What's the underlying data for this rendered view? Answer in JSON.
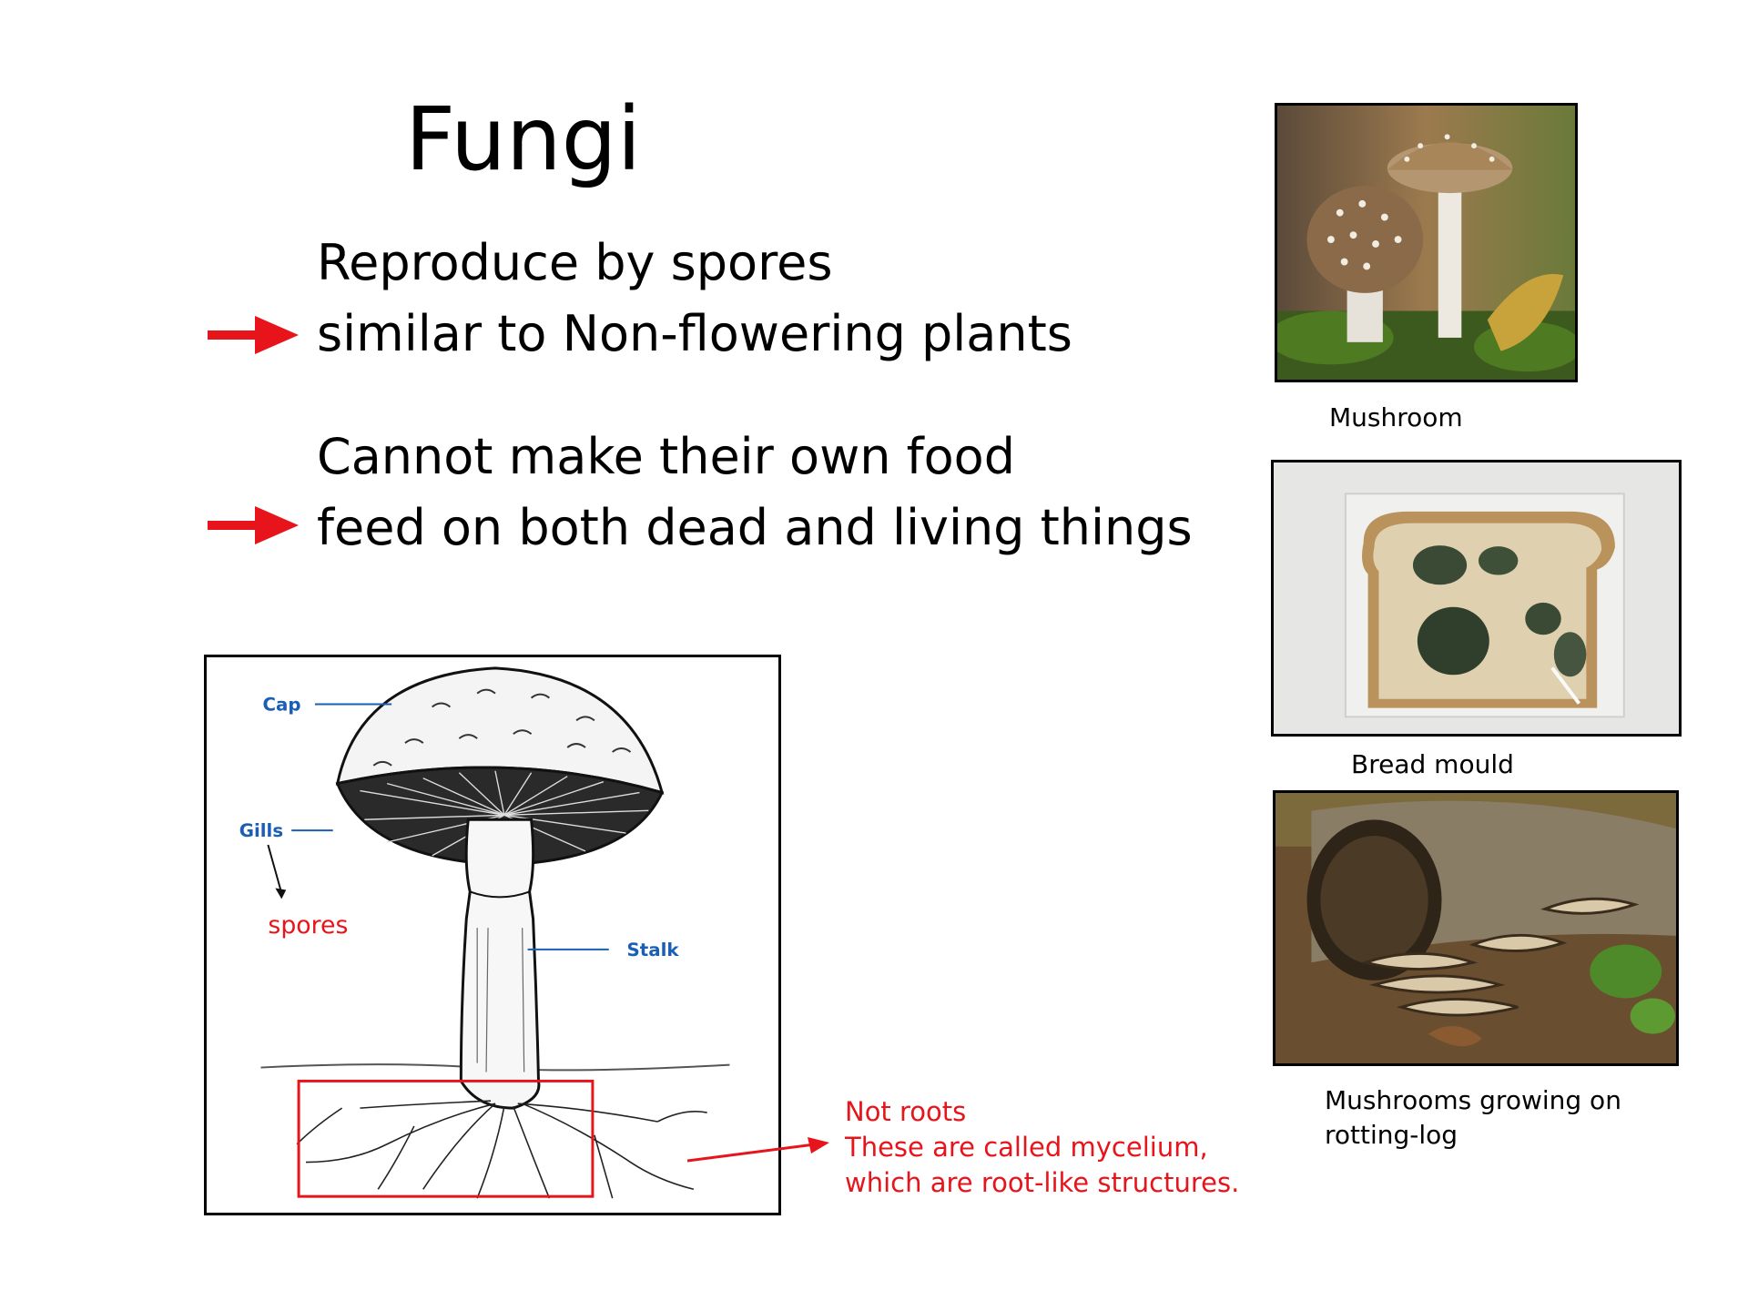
{
  "slide": {
    "title": "Fungi",
    "point1_line1": "Reproduce by spores",
    "point1_line2": "similar to Non-flowering plants",
    "point2_line1": "Cannot make their own food",
    "point2_line2": "feed on both dead and living things"
  },
  "diagram": {
    "label_cap": "Cap",
    "label_gills": "Gills",
    "label_stalk": "Stalk",
    "label_spores": "spores",
    "note_line1": "Not roots",
    "note_line2": "These are called mycelium,",
    "note_line3": "which are root-like structures."
  },
  "photos": {
    "mushroom_caption": "Mushroom",
    "bread_caption": "Bread mould",
    "log_caption_line1": "Mushrooms growing on",
    "log_caption_line2": "rotting-log"
  },
  "colors": {
    "accent_red": "#e8141b",
    "label_blue": "#1a5fb4"
  },
  "icons": [
    "arrow-right-icon"
  ]
}
